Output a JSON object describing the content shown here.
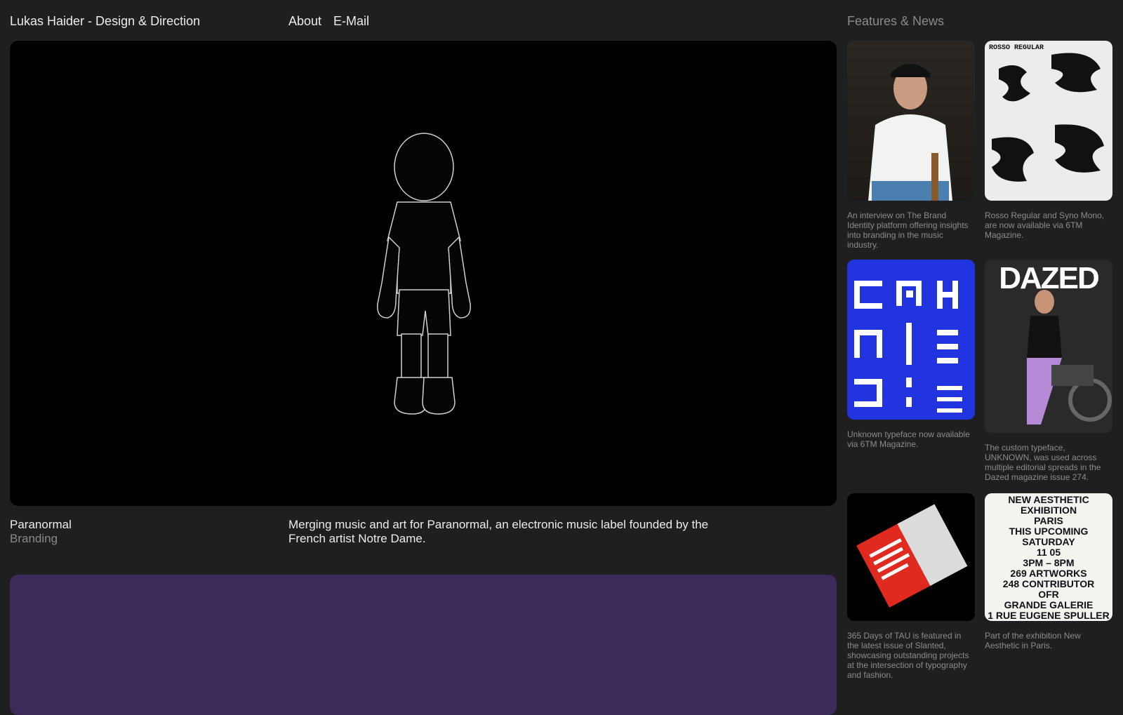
{
  "header": {
    "site_title": "Lukas Haider - Design & Direction",
    "nav": [
      {
        "label": "About"
      },
      {
        "label": "E-Mail"
      }
    ],
    "features_title": "Features & News"
  },
  "project": {
    "name": "Paranormal",
    "category": "Branding",
    "description": "Merging music and art for Paranormal, an electronic music label founded by the French artist Notre Dame."
  },
  "features": [
    {
      "caption": "An interview on The Brand Identity platform offering insights into branding in the music industry."
    },
    {
      "caption": "Rosso Regular and Syno Mono, are now available via 6TM Magazine.",
      "poster_text": "ROSSO REGULAR"
    },
    {
      "caption": "Unknown typeface now available via 6TM Magazine."
    },
    {
      "caption": "The custom typeface, UNKNOWN, was used across multiple editorial spreads in the Dazed magazine issue 274.",
      "logo_text": "DAZED"
    },
    {
      "caption": "365 Days of TAU is featured in the latest issue of Slanted, showcasing outstanding projects at the intersection of typography and fashion."
    },
    {
      "caption": "Part of the exhibition New Aesthetic in Paris.",
      "poster_lines": [
        "NEW AESTHETIC",
        "EXHIBITION",
        "PARIS",
        "THIS UPCOMING",
        "SATURDAY",
        "11 05",
        "3PM – 8PM",
        "269 ARTWORKS",
        "248 CONTRIBUTOR",
        "OFR",
        "GRANDE GALERIE",
        "1 RUE EUGENE SPULLER"
      ]
    }
  ],
  "colors": {
    "background": "#1f1f1f",
    "hero_bg": "#000000",
    "hero2_bg": "#3b2a5a",
    "muted_text": "#8a8a8a"
  }
}
